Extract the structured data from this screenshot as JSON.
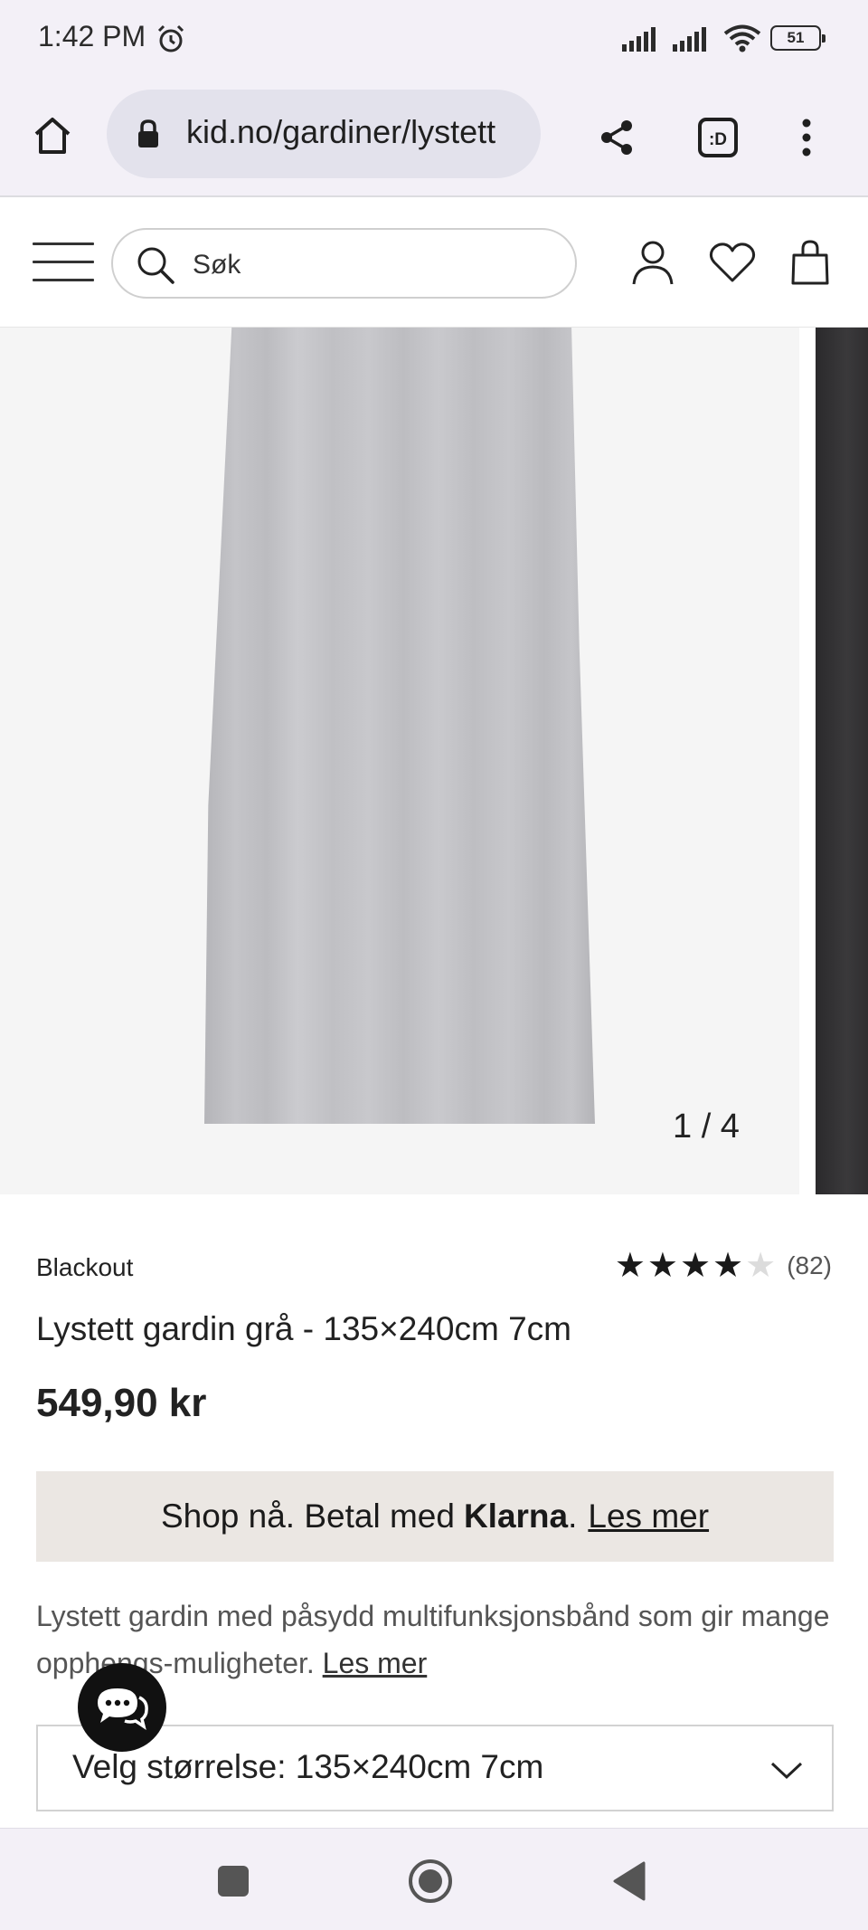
{
  "status_bar": {
    "time": "1:42 PM",
    "battery": "51",
    "alarm_icon": "alarm-clock-icon",
    "signal_icon": "cell-signal-icon",
    "wifi_icon": "wifi-icon"
  },
  "browser": {
    "url": "kid.no/gardiner/lystett",
    "home_icon": "home-icon",
    "share_icon": "share-icon",
    "tabs_icon": "tab-switcher-icon",
    "menu_icon": "overflow-menu-icon"
  },
  "site_header": {
    "search_placeholder": "Søk"
  },
  "gallery": {
    "counter": "1 / 4",
    "current": 1,
    "total": 4
  },
  "product": {
    "brand": "Blackout",
    "rating": 4,
    "rating_max": 5,
    "rating_count": "(82)",
    "title": "Lystett gardin grå - 135×240cm 7cm",
    "price": "549,90 kr"
  },
  "klarna": {
    "text": "Shop nå. Betal med",
    "brand": "Klarna",
    "dot": ".",
    "link": "Les mer"
  },
  "description": {
    "text": "Lystett gardin med påsydd multifunksjonsbånd som gir mange opphengs-muligheter.",
    "link": "Les mer"
  },
  "size_select": {
    "label": "Velg størrelse: 135×240cm 7cm"
  },
  "colors": {
    "status_bg": "#f3f0f7",
    "url_pill": "#e3e2ec",
    "klarna_bg": "#ebe7e3",
    "text_dark": "#222222"
  }
}
